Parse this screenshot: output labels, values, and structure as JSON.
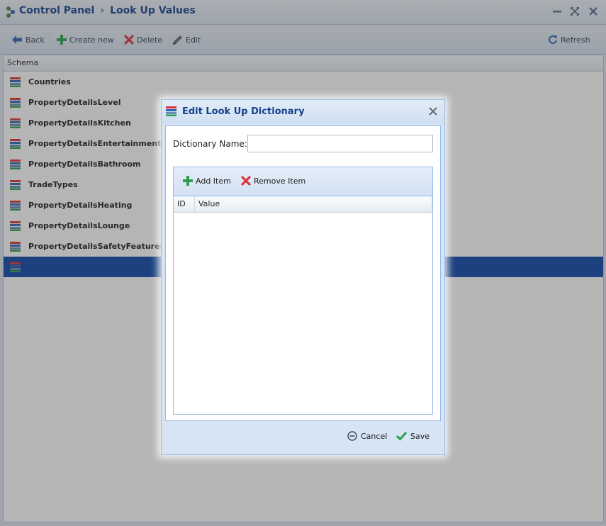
{
  "header": {
    "breadcrumb_root": "Control Panel",
    "breadcrumb_separator": "›",
    "page_title": "Look Up Values"
  },
  "toolbar": {
    "back_label": "Back",
    "create_label": "Create new",
    "delete_label": "Delete",
    "edit_label": "Edit",
    "refresh_label": "Refresh"
  },
  "grid": {
    "column_header": "Schema",
    "rows": [
      "Countries",
      "PropertyDetailsLevel",
      "PropertyDetailsKitchen",
      "PropertyDetailsEntertainment",
      "PropertyDetailsBathroom",
      "TradeTypes",
      "PropertyDetailsHeating",
      "PropertyDetailsLounge",
      "PropertyDetailsSafetyFeatures"
    ],
    "selected_row_label": ""
  },
  "dialog": {
    "title": "Edit Look Up Dictionary",
    "name_label": "Dictionary Name:",
    "name_value": "",
    "add_item_label": "Add Item",
    "remove_item_label": "Remove Item",
    "columns": {
      "id": "ID",
      "value": "Value"
    },
    "cancel_label": "Cancel",
    "save_label": "Save"
  },
  "colors": {
    "accent_title": "#15428b",
    "selected_row": "#0a45a8",
    "add_green": "#2e9e4f",
    "delete_red": "#d9343a"
  },
  "icons": {
    "back": "arrow-left-icon",
    "create": "plus-icon",
    "delete": "x-icon",
    "edit": "pencil-icon",
    "refresh": "refresh-icon",
    "row": "table-stack-icon",
    "cancel": "minus-circle-icon",
    "save": "check-icon",
    "close": "close-icon"
  }
}
